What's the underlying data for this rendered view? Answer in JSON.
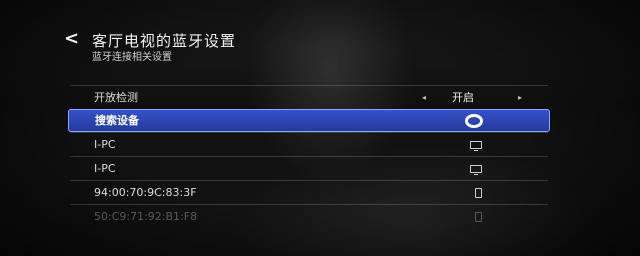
{
  "header": {
    "back_glyph": "<",
    "title": "客厅电视的蓝牙设置",
    "subtitle": "蓝牙连接相关设置"
  },
  "settings": {
    "open_detection": {
      "label": "开放检测",
      "value": "开启",
      "prev_arrow": "◂",
      "next_arrow": "▸"
    }
  },
  "devices": [
    {
      "label": "搜索设备",
      "icon": "search-ring-icon"
    },
    {
      "label": "I-PC",
      "icon": "tv-icon"
    },
    {
      "label": "I-PC",
      "icon": "tv-icon"
    },
    {
      "label": "94:00:70:9C:83:3F",
      "icon": "phone-icon"
    },
    {
      "label": "50:C9:71:92:B1:F8",
      "icon": "phone-icon"
    }
  ],
  "colors": {
    "selection": "#2a44b0",
    "selection_border": "#8ea6ff"
  }
}
